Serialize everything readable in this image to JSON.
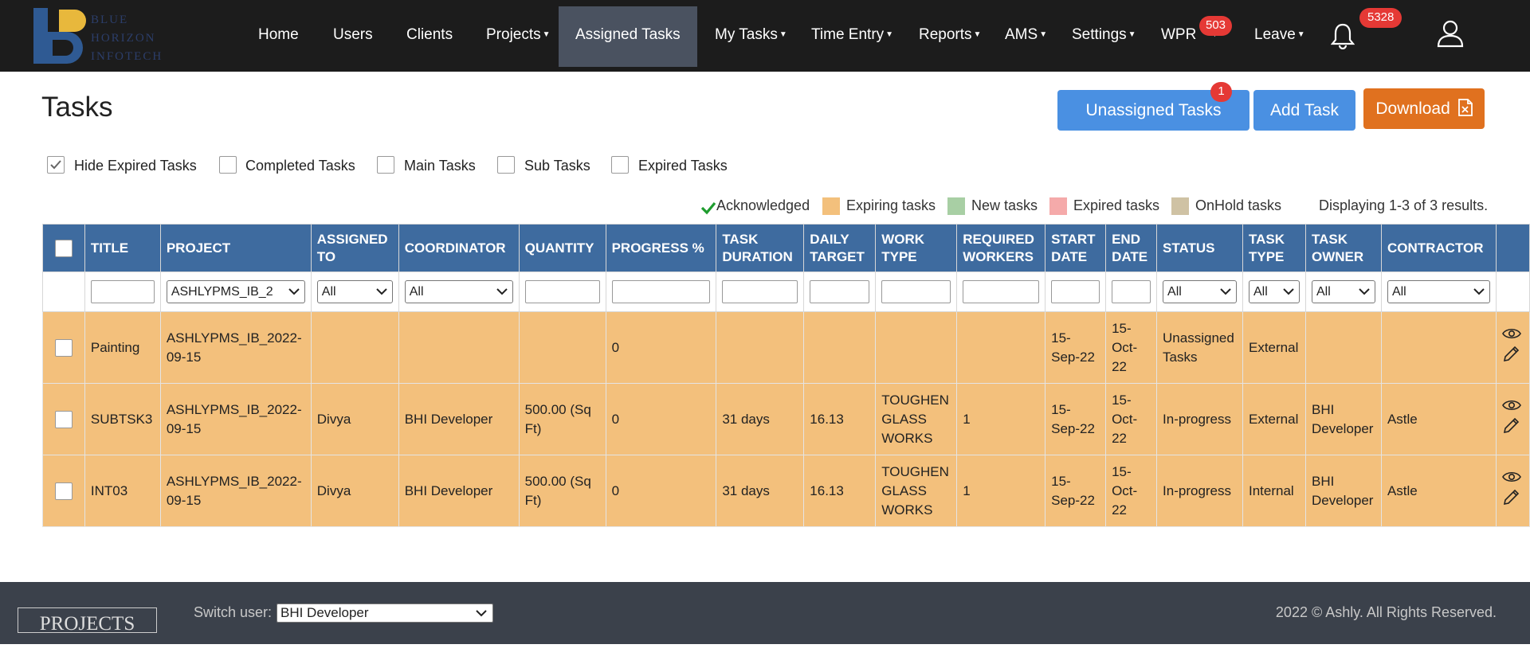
{
  "brand": {
    "line1": "BLUE",
    "line2": "HORIZON",
    "line3": "INFOTECH"
  },
  "nav": {
    "home": "Home",
    "users": "Users",
    "clients": "Clients",
    "projects": "Projects",
    "assigned_tasks": "Assigned Tasks",
    "my_tasks": "My Tasks",
    "time_entry": "Time Entry",
    "reports": "Reports",
    "ams": "AMS",
    "settings": "Settings",
    "wpr": "WPR",
    "wpr_badge": "503",
    "leave": "Leave",
    "notif_badge": "5328"
  },
  "page": {
    "title": "Tasks"
  },
  "buttons": {
    "unassigned": "Unassigned Tasks",
    "unassigned_badge": "1",
    "add_task": "Add Task",
    "download": "Download"
  },
  "filters": {
    "hide_expired": "Hide Expired Tasks",
    "completed": "Completed Tasks",
    "main": "Main Tasks",
    "sub": "Sub Tasks",
    "expired": "Expired Tasks"
  },
  "legend": {
    "acknowledged": "Acknowledged",
    "expiring": "Expiring tasks",
    "new": "New tasks",
    "expired": "Expired tasks",
    "onhold": "OnHold tasks",
    "displaying": "Displaying 1-3 of 3 results."
  },
  "colors": {
    "expiring": "#f3c07c",
    "new": "#a8cfa4",
    "expired": "#f5aaaa",
    "onhold": "#cfc2a4",
    "header": "#3e6b9f"
  },
  "table": {
    "headers": {
      "title": "TITLE",
      "project": "PROJECT",
      "assigned_to_1": "ASSIGNED",
      "assigned_to_2": "TO",
      "coordinator": "COORDINATOR",
      "quantity": "QUANTITY",
      "progress": "PROGRESS %",
      "duration_1": "TASK",
      "duration_2": "DURATION",
      "daily_1": "DAILY",
      "daily_2": "TARGET",
      "work_1": "WORK",
      "work_2": "TYPE",
      "req_1": "REQUIRED",
      "req_2": "WORKERS",
      "start_1": "START",
      "start_2": "DATE",
      "end_1": "END",
      "end_2": "DATE",
      "status": "STATUS",
      "type_1": "TASK",
      "type_2": "TYPE",
      "owner_1": "TASK",
      "owner_2": "OWNER",
      "contractor": "CONTRACTOR"
    },
    "filter_values": {
      "project": "ASHLYPMS_IB_2",
      "assigned_to": "All",
      "coordinator": "All",
      "status": "All",
      "task_type": "All",
      "task_owner": "All",
      "contractor": "All"
    },
    "rows": [
      {
        "title": "Painting",
        "project_1": "ASHLYPMS_IB_2022-",
        "project_2": "09-15",
        "assigned_to": "",
        "coordinator": "",
        "quantity_1": "",
        "quantity_2": "",
        "progress": "0",
        "duration": "",
        "daily_target": "",
        "work_1": "",
        "work_2": "",
        "work_3": "",
        "required_workers": "",
        "start_1": "15-",
        "start_2": "Sep-22",
        "end_1": "15-",
        "end_2": "Oct-",
        "end_3": "22",
        "status_1": "Unassigned",
        "status_2": "Tasks",
        "task_type": "External",
        "owner_1": "",
        "owner_2": "",
        "contractor": ""
      },
      {
        "title": "SUBTSK3",
        "project_1": "ASHLYPMS_IB_2022-",
        "project_2": "09-15",
        "assigned_to": "Divya",
        "coordinator": "BHI Developer",
        "quantity_1": "500.00 (Sq",
        "quantity_2": "Ft)",
        "progress": "0",
        "duration": "31 days",
        "daily_target": "16.13",
        "work_1": "TOUGHEN",
        "work_2": "GLASS",
        "work_3": "WORKS",
        "required_workers": "1",
        "start_1": "15-",
        "start_2": "Sep-22",
        "end_1": "15-",
        "end_2": "Oct-",
        "end_3": "22",
        "status_1": "In-progress",
        "status_2": "",
        "task_type": "External",
        "owner_1": "BHI",
        "owner_2": "Developer",
        "contractor": "Astle"
      },
      {
        "title": "INT03",
        "project_1": "ASHLYPMS_IB_2022-",
        "project_2": "09-15",
        "assigned_to": "Divya",
        "coordinator": "BHI Developer",
        "quantity_1": "500.00 (Sq",
        "quantity_2": "Ft)",
        "progress": "0",
        "duration": "31 days",
        "daily_target": "16.13",
        "work_1": "TOUGHEN",
        "work_2": "GLASS",
        "work_3": "WORKS",
        "required_workers": "1",
        "start_1": "15-",
        "start_2": "Sep-22",
        "end_1": "15-",
        "end_2": "Oct-",
        "end_3": "22",
        "status_1": "In-progress",
        "status_2": "",
        "task_type": "Internal",
        "owner_1": "BHI",
        "owner_2": "Developer",
        "contractor": "Astle"
      }
    ]
  },
  "footer": {
    "logo": "PROJECTS",
    "switch_label": "Switch user:",
    "switch_value": "BHI Developer",
    "copyright": "2022 © Ashly. All Rights Reserved."
  }
}
